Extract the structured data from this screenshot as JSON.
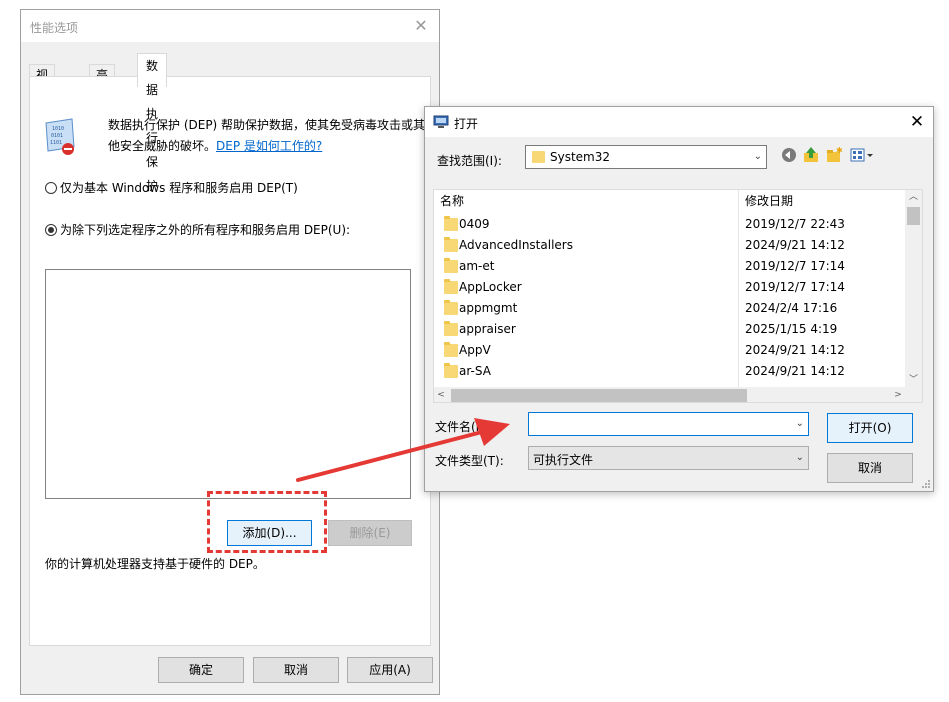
{
  "perf_dialog": {
    "title": "性能选项",
    "tabs": [
      {
        "label": "视觉效果"
      },
      {
        "label": "高级"
      },
      {
        "label": "数据执行保护"
      }
    ],
    "description": "数据执行保护 (DEP) 帮助保护数据，使其免受病毒攻击或其他安全威胁的破坏。",
    "help_link": "DEP 是如何工作的?",
    "radio_essential": "仅为基本 Windows 程序和服务启用 DEP(T)",
    "radio_all_except": "为除下列选定程序之外的所有程序和服务启用 DEP(U):",
    "add_button": "添加(D)...",
    "remove_button": "删除(E)",
    "hardware_support": "你的计算机处理器支持基于硬件的 DEP。",
    "ok_button": "确定",
    "cancel_button": "取消",
    "apply_button": "应用(A)"
  },
  "open_dialog": {
    "title": "打开",
    "lookin_label": "查找范围(I):",
    "lookin_value": "System32",
    "col_name": "名称",
    "col_modified": "修改日期",
    "files": [
      {
        "name": "0409",
        "date": "2019/12/7 22:43"
      },
      {
        "name": "AdvancedInstallers",
        "date": "2024/9/21 14:12"
      },
      {
        "name": "am-et",
        "date": "2019/12/7 17:14"
      },
      {
        "name": "AppLocker",
        "date": "2019/12/7 17:14"
      },
      {
        "name": "appmgmt",
        "date": "2024/2/4 17:16"
      },
      {
        "name": "appraiser",
        "date": "2025/1/15 4:19"
      },
      {
        "name": "AppV",
        "date": "2024/9/21 14:12"
      },
      {
        "name": "ar-SA",
        "date": "2024/9/21 14:12"
      }
    ],
    "filename_label": "文件名(N):",
    "filename_value": "",
    "filetype_label": "文件类型(T):",
    "filetype_value": "可执行文件",
    "open_button": "打开(O)",
    "cancel_button": "取消"
  },
  "colors": {
    "annotation_red": "#e53935",
    "link_blue": "#0066cc",
    "focus_blue": "#0078d7"
  }
}
